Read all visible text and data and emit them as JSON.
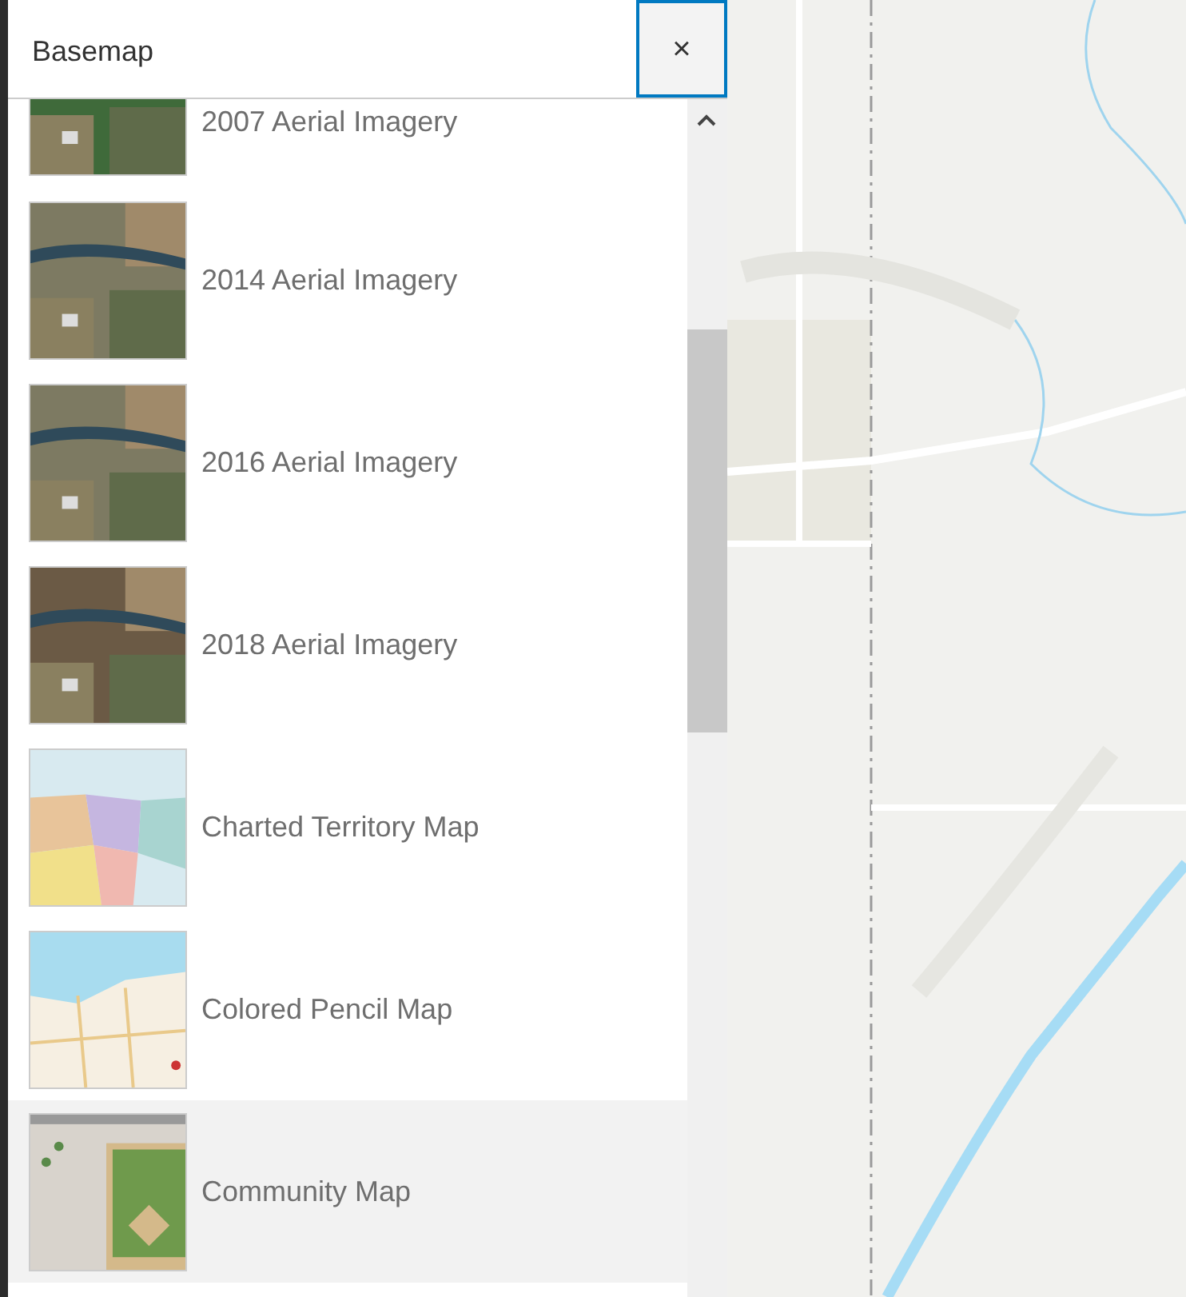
{
  "panel": {
    "title": "Basemap",
    "close_button": {
      "label": "×"
    }
  },
  "basemaps": [
    {
      "label": "2007 Aerial Imagery",
      "selected": false
    },
    {
      "label": "2014 Aerial Imagery",
      "selected": false
    },
    {
      "label": "2016 Aerial Imagery",
      "selected": false
    },
    {
      "label": "2018 Aerial Imagery",
      "selected": false
    },
    {
      "label": "Charted Territory Map",
      "selected": false
    },
    {
      "label": "Colored Pencil Map",
      "selected": false
    },
    {
      "label": "Community Map",
      "selected": true
    }
  ]
}
